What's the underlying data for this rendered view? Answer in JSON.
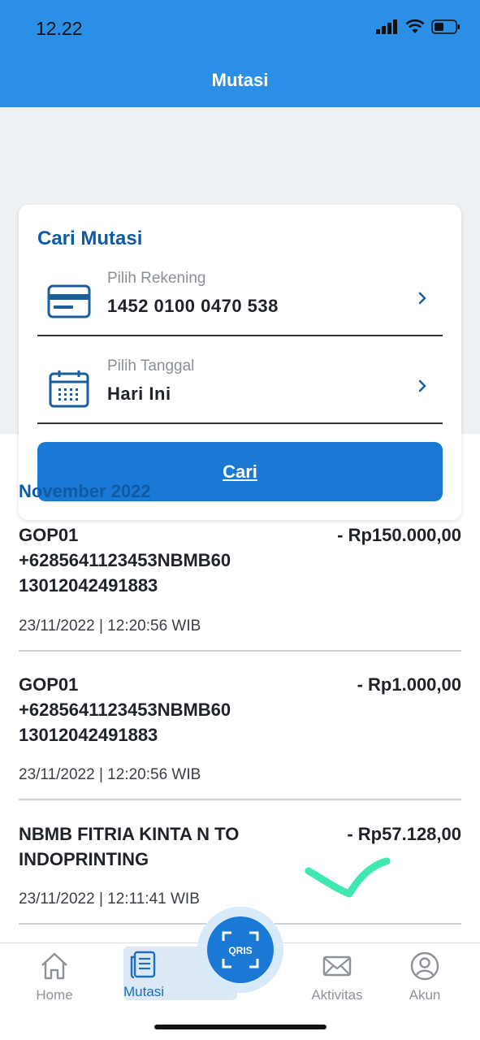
{
  "status_bar": {
    "time": "12.22"
  },
  "header": {
    "title": "Mutasi"
  },
  "search": {
    "title": "Cari Mutasi",
    "account": {
      "label": "Pilih Rekening",
      "value": "1452 0100 0470 538",
      "icon": "credit-card-icon"
    },
    "date": {
      "label": "Pilih Tanggal",
      "value": "Hari Ini",
      "icon": "calendar-icon"
    },
    "button_label": "Cari"
  },
  "transactions": {
    "month": "November 2022",
    "items": [
      {
        "description": "GOP01 +6285641123453NBMB60 13012042491883",
        "amount": "- Rp150.000,00",
        "datetime": "23/11/2022 | 12:20:56 WIB"
      },
      {
        "description": "GOP01 +6285641123453NBMB60 13012042491883",
        "amount": "- Rp1.000,00",
        "datetime": "23/11/2022 | 12:20:56 WIB"
      },
      {
        "description": "NBMB FITRIA KINTA N TO INDOPRINTING",
        "amount": "- Rp57.128,00",
        "datetime": "23/11/2022 | 12:11:41 WIB"
      }
    ]
  },
  "nav": {
    "home": "Home",
    "mutasi": "Mutasi",
    "qris": "QRIS",
    "aktivitas": "Aktivitas",
    "akun": "Akun"
  },
  "colors": {
    "header": "#2b8fe6",
    "primary": "#1a79d4",
    "title": "#0d5aa7",
    "annotation": "#3ee8b0"
  }
}
